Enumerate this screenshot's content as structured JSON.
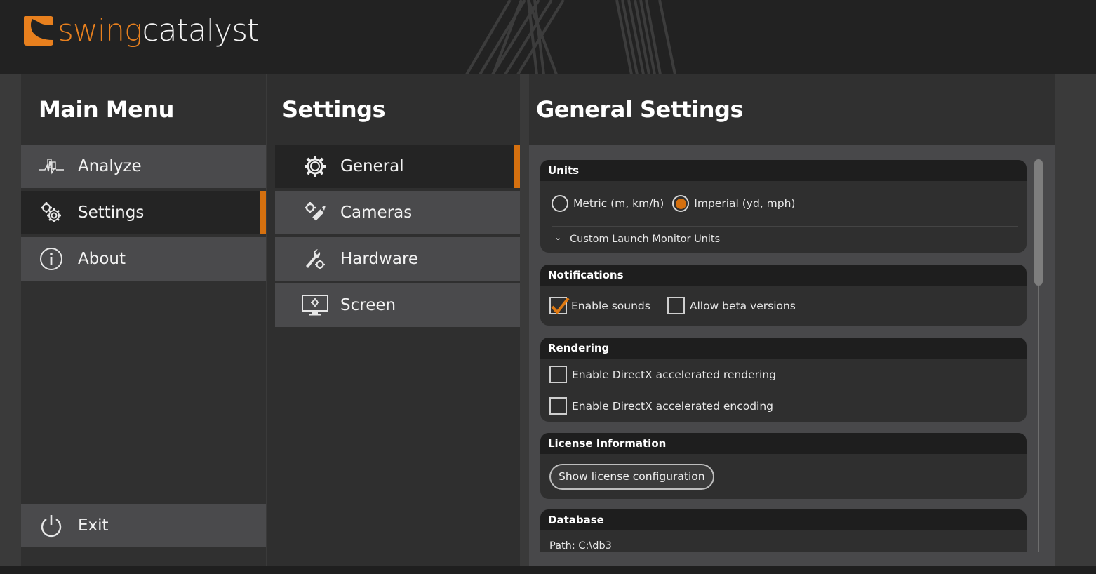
{
  "app": {
    "logo_part1": "swing",
    "logo_part2": "catalyst",
    "brand_color": "#e8801e",
    "accent_color": "#d5700f"
  },
  "main_menu": {
    "title": "Main Menu",
    "items": [
      {
        "label": "Analyze",
        "icon": "analyze-chart-icon",
        "active": false
      },
      {
        "label": "Settings",
        "icon": "gears-icon",
        "active": true
      },
      {
        "label": "About",
        "icon": "info-icon",
        "active": false
      }
    ],
    "exit": {
      "label": "Exit",
      "icon": "power-icon"
    }
  },
  "settings_menu": {
    "title": "Settings",
    "items": [
      {
        "label": "General",
        "icon": "gear-icon",
        "active": true
      },
      {
        "label": "Cameras",
        "icon": "camera-gear-icon",
        "active": false
      },
      {
        "label": "Hardware",
        "icon": "wrench-gear-icon",
        "active": false
      },
      {
        "label": "Screen",
        "icon": "monitor-gear-icon",
        "active": false
      }
    ]
  },
  "general": {
    "title": "General Settings",
    "units": {
      "header": "Units",
      "options": [
        {
          "label": "Metric (m, km/h)",
          "selected": false
        },
        {
          "label": "Imperial (yd, mph)",
          "selected": true
        }
      ],
      "expander_label": "Custom Launch Monitor Units",
      "expander_glyph": "⌄"
    },
    "notifications": {
      "header": "Notifications",
      "options": [
        {
          "label": "Enable sounds",
          "checked": true
        },
        {
          "label": "Allow beta versions",
          "checked": false
        }
      ]
    },
    "rendering": {
      "header": "Rendering",
      "options": [
        {
          "label": "Enable DirectX accelerated rendering",
          "checked": false
        },
        {
          "label": "Enable DirectX accelerated encoding",
          "checked": false
        }
      ]
    },
    "license": {
      "header": "License Information",
      "button_label": "Show license configuration"
    },
    "database": {
      "header": "Database",
      "path_text": "Path: C:\\db3"
    }
  }
}
